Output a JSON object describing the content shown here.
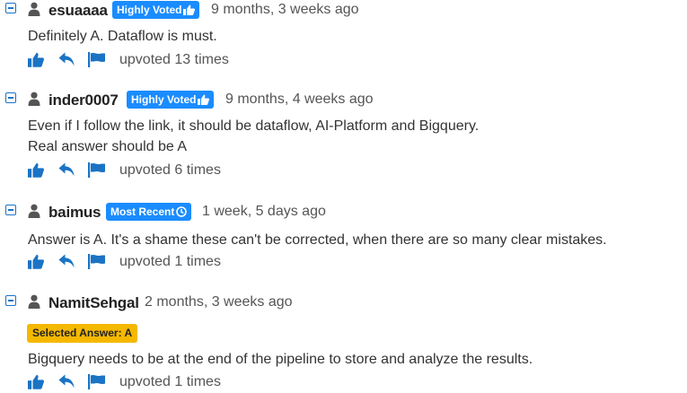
{
  "colors": {
    "accent_blue": "#1a73c4",
    "badge_blue": "#1a8cff",
    "selected_yellow": "#f5b800"
  },
  "icons": {
    "toggle": "minus-square-icon",
    "user": "user-icon",
    "upvote": "thumbs-up-icon",
    "reply": "reply-arrow-icon",
    "report": "flag-icon",
    "highly_voted": "thumbs-up-icon",
    "most_recent": "clock-icon"
  },
  "comments": [
    {
      "username": "esuaaaa",
      "badge": "Highly Voted",
      "time_ago": "9 months, 3 weeks ago",
      "lines": [
        "Definitely A. Dataflow is must."
      ],
      "upvotes": "upvoted 13 times"
    },
    {
      "username": "inder0007",
      "badge": "Highly Voted",
      "time_ago": "9 months, 4 weeks ago",
      "lines": [
        "Even if I follow the link, it should be dataflow, AI-Platform and Bigquery.",
        "Real answer should be A"
      ],
      "upvotes": "upvoted 6 times"
    },
    {
      "username": "baimus",
      "badge": "Most Recent",
      "time_ago": "1 week, 5 days ago",
      "lines": [
        "Answer is A. It's a shame these can't be corrected, when there are so many clear mistakes."
      ],
      "upvotes": "upvoted 1 times"
    },
    {
      "username": "NamitSehgal",
      "time_ago": "2 months, 3 weeks ago",
      "selected_answer": "Selected Answer: A",
      "lines": [
        "Bigquery needs to be at the end of the pipeline to store and analyze the results."
      ],
      "upvotes": "upvoted 1 times"
    }
  ]
}
